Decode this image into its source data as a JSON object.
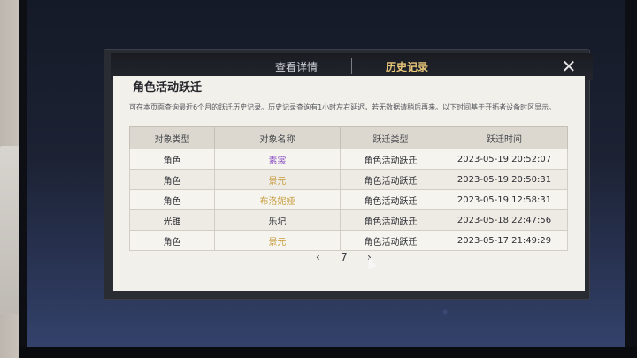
{
  "dialog": {
    "tabs": [
      {
        "label": "查看详情",
        "active": false
      },
      {
        "label": "历史记录",
        "active": true
      }
    ],
    "close_icon": "close-icon"
  },
  "panel": {
    "title": "角色活动跃迁",
    "note": "可在本页面查询最近6个月的跃迁历史记录。历史记录查询有1小时左右延迟，若无数据请稍后再来。以下时间基于开拓者设备时区显示。"
  },
  "table": {
    "headers": [
      "对象类型",
      "对象名称",
      "跃迁类型",
      "跃迁时间"
    ],
    "rows": [
      {
        "type": "角色",
        "name": "素裳",
        "name_color": "#8e57c6",
        "jump": "角色活动跃迁",
        "time": "2023-05-19 20:52:07"
      },
      {
        "type": "角色",
        "name": "景元",
        "name_color": "#c69b3c",
        "jump": "角色活动跃迁",
        "time": "2023-05-19 20:50:31"
      },
      {
        "type": "角色",
        "name": "布洛妮娅",
        "name_color": "#c69b3c",
        "jump": "角色活动跃迁",
        "time": "2023-05-19 12:58:31"
      },
      {
        "type": "光锥",
        "name": "乐圮",
        "name_color": "#3a3c41",
        "jump": "角色活动跃迁",
        "time": "2023-05-18 22:47:56"
      },
      {
        "type": "角色",
        "name": "景元",
        "name_color": "#c69b3c",
        "jump": "角色活动跃迁",
        "time": "2023-05-17 21:49:29"
      }
    ]
  },
  "pager": {
    "prev": "‹",
    "page": "7",
    "next": "›"
  },
  "colors": {
    "accent": "#d3a94a",
    "purple_rarity": "#8e57c6",
    "gold_rarity": "#c69b3c"
  }
}
